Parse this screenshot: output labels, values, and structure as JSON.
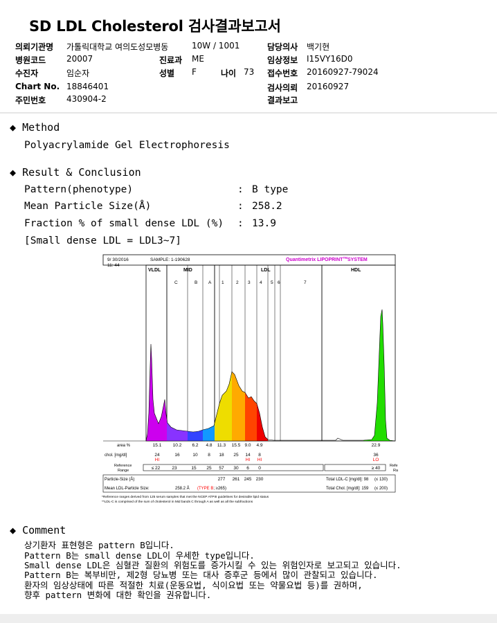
{
  "title": "SD LDL Cholesterol 검사결과보고서",
  "header": {
    "institution_label": "의뢰기관명",
    "institution": "가톨릭대학교 여의도성모병동",
    "ward": "10W / 1001",
    "doctor_label": "담당의사",
    "doctor": "백기현",
    "hospital_code_label": "병원코드",
    "hospital_code": "20007",
    "dept_label": "진료과",
    "dept": "ME",
    "clinical_label": "임상정보",
    "clinical": "I15VY16D0",
    "patient_label": "수진자",
    "patient": "임순자",
    "sex_label": "성별",
    "sex": "F",
    "age_label": "나이",
    "age": "73",
    "receipt_label": "접수번호",
    "receipt": "20160927-79024",
    "chart_label": "Chart No.",
    "chart": "18846401",
    "request_date_label": "검사의뢰",
    "request_date": "20160927",
    "resident_label": "주민번호",
    "resident": "430904-2",
    "report_label": "결과보고",
    "report": ""
  },
  "method": {
    "heading": "Method",
    "text": "Polyacrylamide Gel Electrophoresis"
  },
  "result": {
    "heading": "Result & Conclusion",
    "rows": [
      {
        "label": "Pattern(phenotype)",
        "colon": ":",
        "value": "B type"
      },
      {
        "label": "Mean Particle Size(Å)",
        "colon": ":",
        "value": "258.2"
      },
      {
        "label": "Fraction % of small dense LDL (%)",
        "colon": ":",
        "value": "13.9"
      }
    ],
    "note": "[Small dense LDL = LDL3~7]"
  },
  "report_figure": {
    "date": "9/ 30/2016",
    "time": "11: 44",
    "sample": "SAMPLE:   1-190628",
    "brand": "Quantimetrix LIPOPRINT",
    "brand_tm": "TM",
    "brand_sys": "SYSTEM",
    "groups": {
      "vldl": "VLDL",
      "mid": "MID",
      "ldl": "LDL",
      "hdl": "HDL"
    },
    "bands": [
      "C",
      "B",
      "A",
      "1",
      "2",
      "3",
      "4",
      "5",
      "6",
      "7"
    ],
    "row_labels": {
      "area": "area %",
      "chol": "chol. [mg/dl]",
      "ref": "Reference\nRange",
      "ref_right": "Reference\nRange",
      "psize": "Particle-Size (Å)",
      "mean": "Mean LDL-Particle Size:"
    },
    "area_values": [
      "15.1",
      "10.2",
      "6.2",
      "4.8",
      "11.3",
      "15.5",
      "9.0",
      "4.9",
      "22.9"
    ],
    "chol_values": [
      "24",
      "16",
      "10",
      "8",
      "18",
      "25",
      "14",
      "8",
      "36"
    ],
    "chol_flags": [
      "HI",
      "",
      "",
      "",
      "",
      "",
      "HI",
      "HI",
      "LO"
    ],
    "ref_values": [
      "≤ 22",
      "23",
      "15",
      "25",
      "57",
      "30",
      "6",
      "0",
      "≥ 40"
    ],
    "particle_sizes": [
      "277",
      "261",
      "245",
      "230"
    ],
    "mean_value": "258.2 Å",
    "mean_type": "(TYPE B",
    "mean_type2": "; ≥265)",
    "total_ldl": "Total LDL-C [mg/dl]:  98",
    "total_ldl_ref": "(≤ 130)",
    "total_chol": "Total Chol. [mg/dl]:   159",
    "total_chol_ref": "(≤ 200)",
    "footnote1": "*Reference ranges derived from 125 serum samples that met the NCEP ATPIII guidelines for desirable lipid status",
    "footnote2": "**LDL-C is comprised of the sum of cholesterol in Mid bands C through A as well as all the subfractions"
  },
  "chart_data": {
    "type": "area",
    "title": "",
    "xlabel": "",
    "ylabel": "",
    "series": [
      {
        "values": [
          15.1,
          10.2,
          6.2,
          4.8,
          11.3,
          15.5,
          9.0,
          4.9,
          22.9
        ]
      }
    ],
    "categories": [
      "VLDL",
      "C",
      "B",
      "A",
      "1",
      "2",
      "3",
      "4",
      "HDL"
    ],
    "colors": [
      "#cc00ee",
      "#8833ff",
      "#3344ff",
      "#1199ff",
      "#eedd00",
      "#ffaa00",
      "#ff4400",
      "#ee0000",
      "#22dd00"
    ]
  },
  "comment": {
    "heading": "Comment",
    "lines": [
      "상기환자 표현형은 pattern B입니다.",
      "Pattern B는 small dense LDL이 우세한 type입니다.",
      "Small dense LDL은 심혈관 질환의 위험도를 증가시킬 수 있는 위험인자로 보고되고 있습니다.",
      "Pattern B는 복부비만, 제2형 당뇨병 또는 대사 증후군 등에서 많이 관찰되고 있습니다.",
      "환자의 임상상태에 따른 적절한 치료(운동요법, 식이요법 또는 약물요법 등)를 권하며,",
      "향후 pattern 변화에 대한 확인을 권유합니다."
    ]
  }
}
